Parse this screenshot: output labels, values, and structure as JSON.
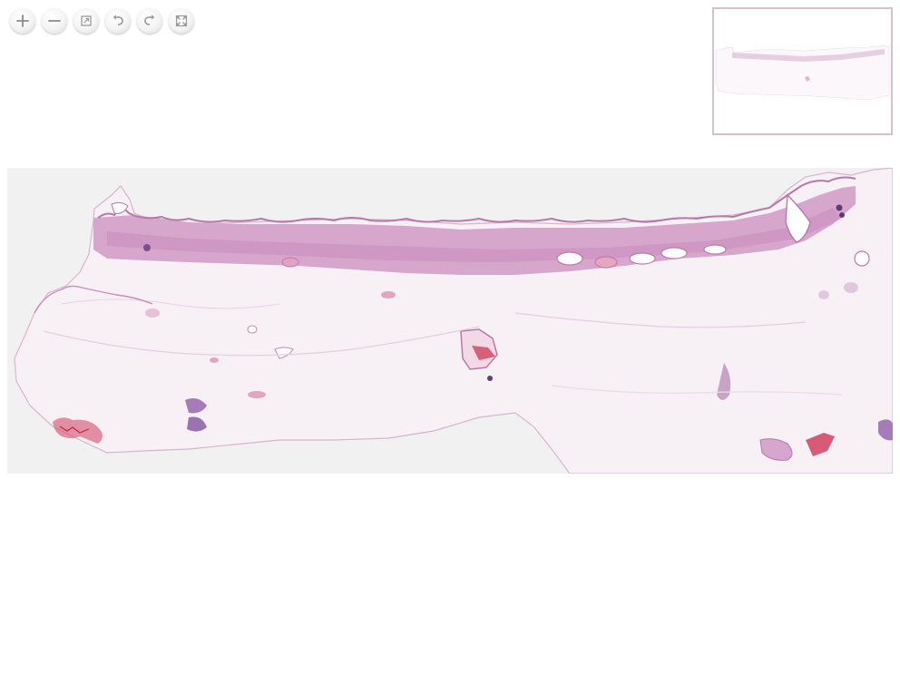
{
  "toolbar": {
    "buttons": [
      {
        "name": "zoom-in-button",
        "icon": "plus-icon"
      },
      {
        "name": "zoom-out-button",
        "icon": "minus-icon"
      },
      {
        "name": "home-button",
        "icon": "home-fit-icon"
      },
      {
        "name": "rotate-left-button",
        "icon": "rotate-left-icon"
      },
      {
        "name": "rotate-right-button",
        "icon": "rotate-right-icon"
      },
      {
        "name": "fullscreen-button",
        "icon": "fullscreen-icon"
      }
    ]
  },
  "navigator": {
    "border_color": "#d9c0c8"
  },
  "slide": {
    "background_color": "#f1f1f1",
    "tissue_stroma_color": "#f7f0f5",
    "tissue_dense_color": "#d7a6cc",
    "tissue_edge_color": "#b679a8",
    "blood_color": "#d2405e"
  }
}
